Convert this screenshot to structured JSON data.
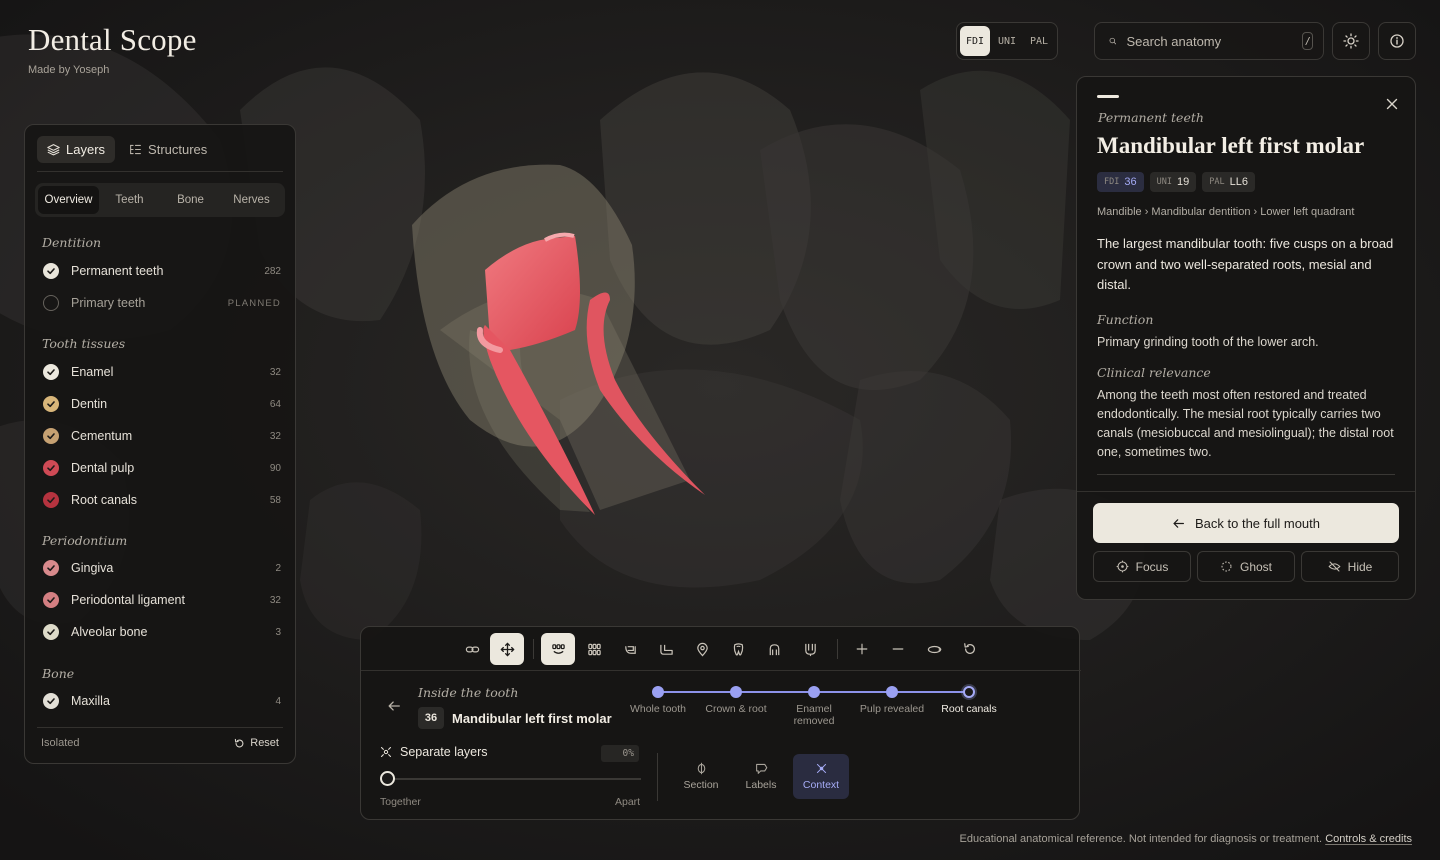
{
  "brand": {
    "title": "Dental Scope",
    "subtitle": "Made by Yoseph"
  },
  "notation": {
    "options": [
      "FDI",
      "UNI",
      "PAL"
    ],
    "selected": "FDI"
  },
  "search": {
    "placeholder": "Search anatomy",
    "shortcut": "/"
  },
  "header_icons": [
    "sun-icon",
    "info-icon"
  ],
  "left_panel": {
    "tabs": [
      {
        "label": "Layers",
        "icon": "layers-icon",
        "active": true
      },
      {
        "label": "Structures",
        "icon": "list-tree-icon",
        "active": false
      }
    ],
    "subtabs": [
      {
        "label": "Overview",
        "active": true
      },
      {
        "label": "Teeth",
        "active": false
      },
      {
        "label": "Bone",
        "active": false
      },
      {
        "label": "Nerves",
        "active": false
      }
    ],
    "sections": [
      {
        "title": "Dentition",
        "items": [
          {
            "label": "Permanent teeth",
            "count": "282",
            "checked": true,
            "color": "#e9e5da"
          },
          {
            "label": "Primary teeth",
            "count": "PLANNED",
            "checked": false,
            "color": ""
          }
        ]
      },
      {
        "title": "Tooth tissues",
        "items": [
          {
            "label": "Enamel",
            "count": "32",
            "checked": true,
            "color": "#ece8de"
          },
          {
            "label": "Dentin",
            "count": "64",
            "checked": true,
            "color": "#d8b67a"
          },
          {
            "label": "Cementum",
            "count": "32",
            "checked": true,
            "color": "#c6a172"
          },
          {
            "label": "Dental pulp",
            "count": "90",
            "checked": true,
            "color": "#cf4a55"
          },
          {
            "label": "Root canals",
            "count": "58",
            "checked": true,
            "color": "#b5333f"
          }
        ]
      },
      {
        "title": "Periodontium",
        "items": [
          {
            "label": "Gingiva",
            "count": "2",
            "checked": true,
            "color": "#d88a8c"
          },
          {
            "label": "Periodontal ligament",
            "count": "32",
            "checked": true,
            "color": "#d47f82"
          },
          {
            "label": "Alveolar bone",
            "count": "3",
            "checked": true,
            "color": "#dedbc9"
          }
        ]
      },
      {
        "title": "Bone",
        "items": [
          {
            "label": "Maxilla",
            "count": "4",
            "checked": true,
            "color": "#e2dfd6"
          }
        ]
      }
    ],
    "footer": {
      "status": "Isolated",
      "reset_label": "Reset"
    }
  },
  "detail": {
    "eyebrow": "Permanent teeth",
    "title": "Mandibular left first molar",
    "codes": [
      {
        "key": "FDI",
        "value": "36"
      },
      {
        "key": "UNI",
        "value": "19"
      },
      {
        "key": "PAL",
        "value": "LL6"
      }
    ],
    "breadcrumb": "Mandible › Mandibular dentition › Lower left quadrant",
    "description": "The largest mandibular tooth: five cusps on a broad crown and two well-separated roots, mesial and distal.",
    "function_title": "Function",
    "function_text": "Primary grinding tooth of the lower arch.",
    "clinical_title": "Clinical relevance",
    "clinical_text": "Among the teeth most often restored and treated endodontically. The mesial root typically carries two canals (mesiobuccal and mesiolingual); the distal root one, sometimes two.",
    "back_label": "Back to the full mouth",
    "actions": [
      "Focus",
      "Ghost",
      "Hide"
    ]
  },
  "dock": {
    "toolbar_icons": [
      "link-icon",
      "move-icon",
      "arch-view-icon",
      "grid-view-icon",
      "side-view-icon",
      "lower-jaw-icon",
      "tooth-marker-icon",
      "tooth-outline-icon",
      "incisor-icon",
      "molar-icon",
      "zoom-in-icon",
      "zoom-out-icon",
      "orbit-icon",
      "reset-view-icon"
    ],
    "eyebrow": "Inside the tooth",
    "tooth_number": "36",
    "tooth_name": "Mandibular left first molar",
    "steps": [
      {
        "label": "Whole tooth",
        "state": "done"
      },
      {
        "label": "Crown & root",
        "state": "done"
      },
      {
        "label": "Enamel removed",
        "state": "done"
      },
      {
        "label": "Pulp revealed",
        "state": "done"
      },
      {
        "label": "Root canals",
        "state": "current"
      }
    ],
    "separate_label": "Separate layers",
    "separate_value": "0%",
    "separate_fraction": 0,
    "slider_min_label": "Together",
    "slider_max_label": "Apart",
    "view_buttons": [
      {
        "label": "Section",
        "icon": "section-icon",
        "active": false
      },
      {
        "label": "Labels",
        "icon": "labels-icon",
        "active": false
      },
      {
        "label": "Context",
        "icon": "context-icon",
        "active": true
      }
    ]
  },
  "footer": {
    "disclaimer": "Educational anatomical reference. Not intended for diagnosis or treatment.",
    "link": "Controls & credits"
  },
  "colors": {
    "accent": "#9aa0f2",
    "primary_button": "#ece8de",
    "pulp": "#e4646c",
    "background": "#1b1a19"
  }
}
